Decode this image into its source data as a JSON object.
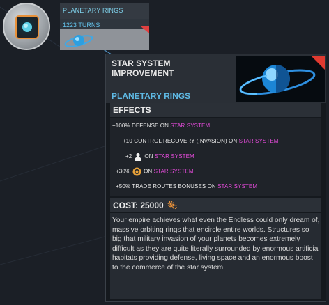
{
  "queue": {
    "name": "PLANETARY RINGS",
    "turns": "1223 TURNS"
  },
  "tooltip": {
    "type_line1": "STAR SYSTEM",
    "type_line2": "IMPROVEMENT",
    "name": "PLANETARY RINGS",
    "effects_title": "EFFECTS",
    "effects": [
      {
        "prefix": "+100% DEFENSE ON ",
        "target": "STAR SYSTEM"
      },
      {
        "prefix": "+10 CONTROL RECOVERY (INVASION) ON ",
        "target": "STAR SYSTEM"
      },
      {
        "prefix": "+2",
        "icon": "population-icon",
        "middle": "ON ",
        "target": "STAR SYSTEM"
      },
      {
        "prefix": "+30%",
        "icon": "influence-icon",
        "middle": "ON ",
        "target": "STAR SYSTEM"
      },
      {
        "prefix": "+50% TRADE ROUTES BONUSES ON ",
        "target": "STAR SYSTEM"
      }
    ],
    "cost_label": "COST: 25000",
    "description": "Your empire achieves what even the Endless could only dream of, massive orbiting rings that encircle entire worlds. Structures so big that military invasion of your planets becomes extremely difficult as they are quite literally surrounded by enormous artificial habitats providing defense, living space and an enormous boost to the commerce of the star system."
  },
  "colors": {
    "accent_blue": "#5eb9e4",
    "target_pink": "#e04ad6",
    "flag_red": "#e03a30",
    "ring_orange": "#e8913a"
  }
}
